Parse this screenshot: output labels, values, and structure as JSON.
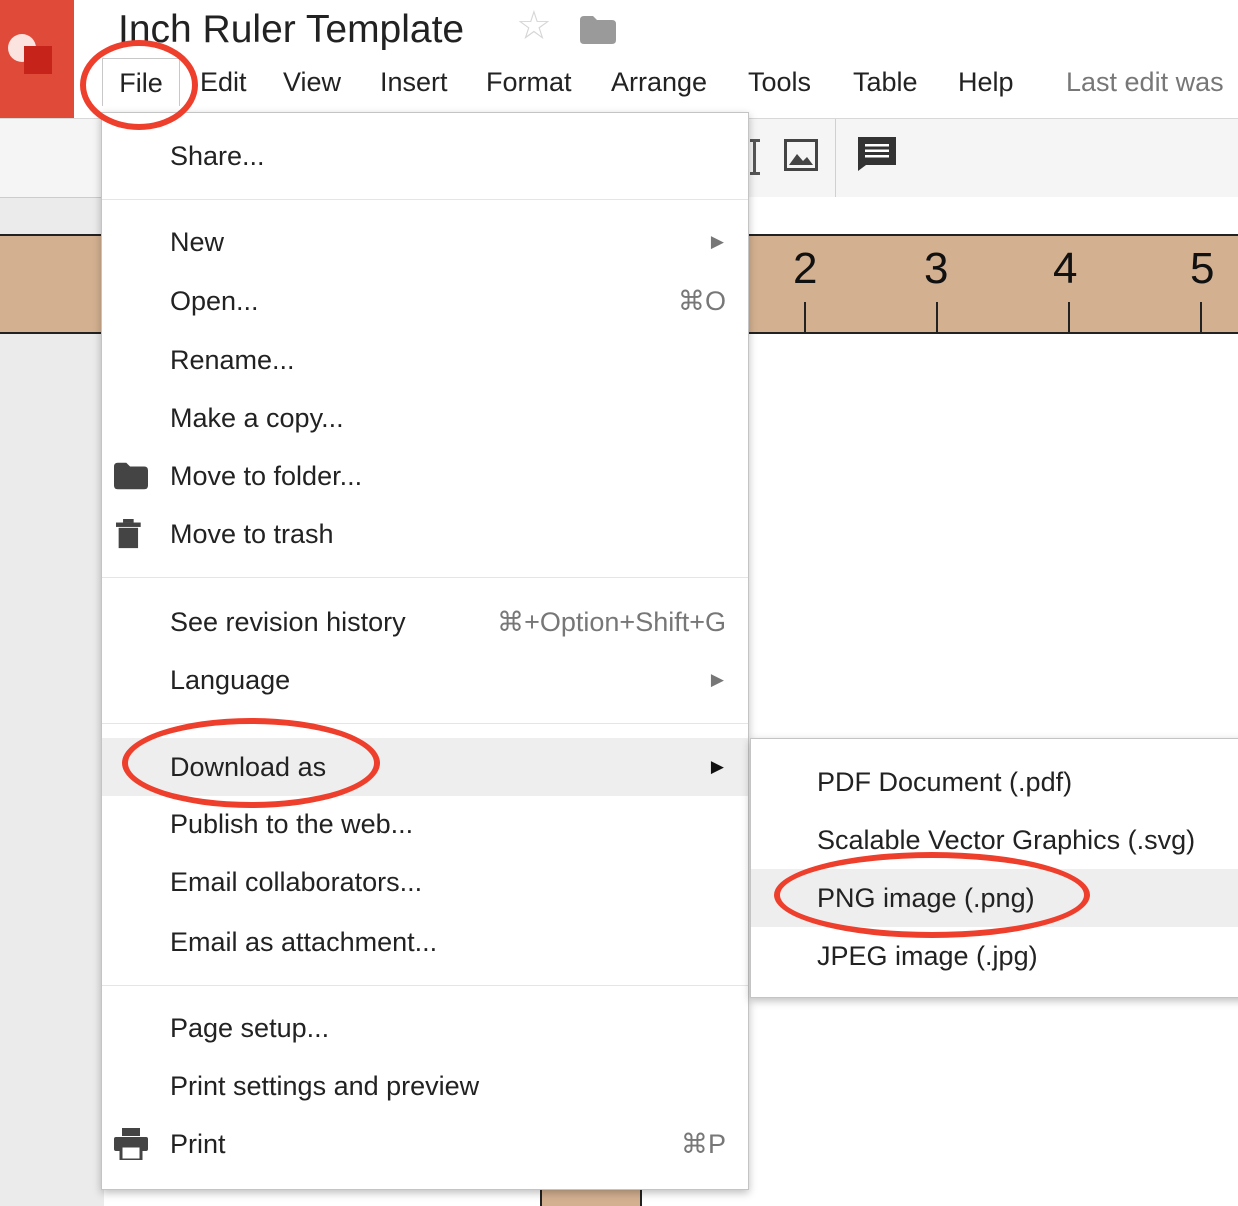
{
  "app": {
    "title": "Inch Ruler Template",
    "last_edit": "Last edit was"
  },
  "menubar": {
    "items": [
      "File",
      "Edit",
      "View",
      "Insert",
      "Format",
      "Arrange",
      "Tools",
      "Table",
      "Help"
    ]
  },
  "ruler": {
    "numbers": [
      "2",
      "3",
      "4",
      "5"
    ]
  },
  "file_menu": {
    "share": "Share...",
    "new": "New",
    "open": "Open...",
    "open_shortcut": "⌘O",
    "rename": "Rename...",
    "make_copy": "Make a copy...",
    "move_to_folder": "Move to folder...",
    "move_to_trash": "Move to trash",
    "revision_history": "See revision history",
    "revision_shortcut": "⌘+Option+Shift+G",
    "language": "Language",
    "download_as": "Download as",
    "publish": "Publish to the web...",
    "email_collaborators": "Email collaborators...",
    "email_attachment": "Email as attachment...",
    "page_setup": "Page setup...",
    "print_settings": "Print settings and preview",
    "print": "Print",
    "print_shortcut": "⌘P"
  },
  "download_submenu": {
    "pdf": "PDF Document (.pdf)",
    "svg": "Scalable Vector Graphics (.svg)",
    "png": "PNG image (.png)",
    "jpg": "JPEG image (.jpg)"
  },
  "annotations": {
    "color": "#ee3e2c",
    "highlighted": [
      "File",
      "Download as",
      "PNG image (.png)"
    ]
  },
  "colors": {
    "brand": "#e04a39",
    "ruler": "#d3b090",
    "hover": "#eeeeee"
  }
}
